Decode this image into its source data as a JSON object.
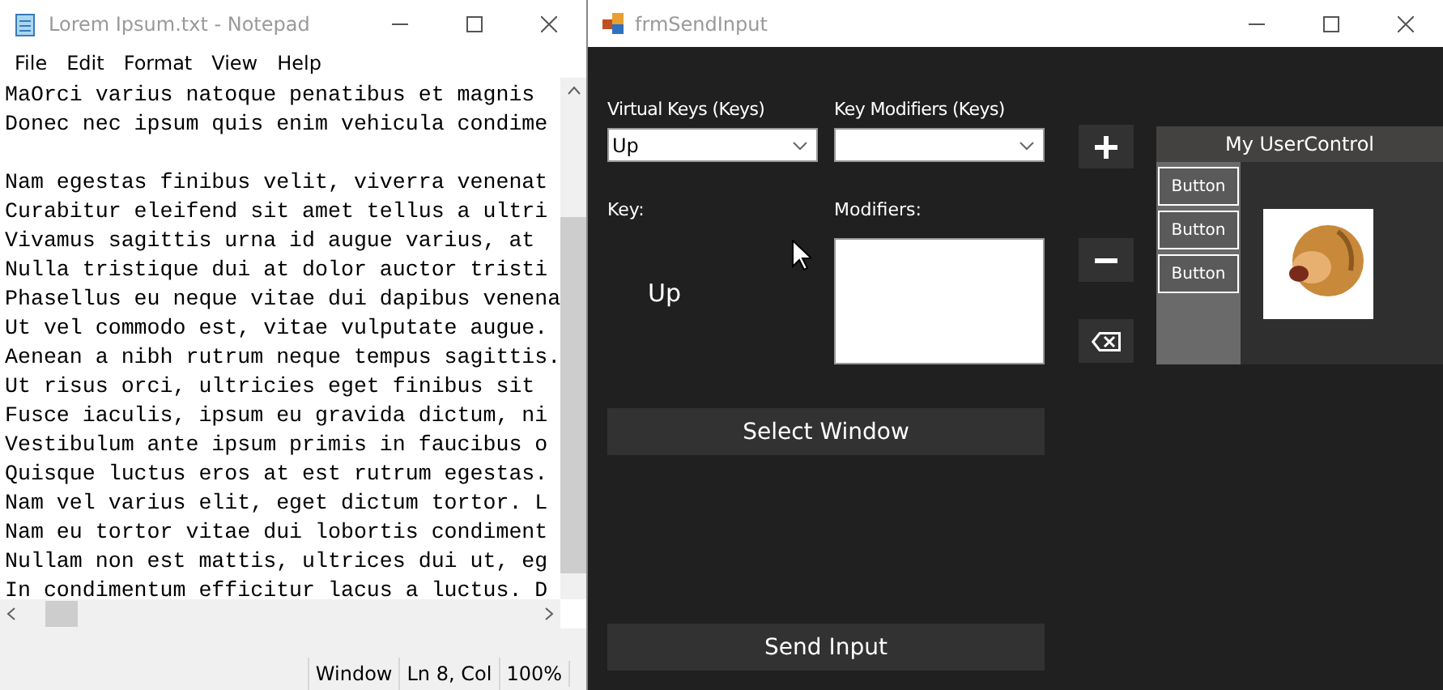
{
  "notepad": {
    "title": "Lorem Ipsum.txt - Notepad",
    "menu": [
      "File",
      "Edit",
      "Format",
      "View",
      "Help"
    ],
    "paragraphs": [
      [
        "MaOrci varius natoque penatibus et magnis",
        "Donec nec ipsum quis enim vehicula condime"
      ],
      [
        "Nam egestas finibus velit, viverra venenat",
        "Curabitur eleifend sit amet tellus a ultri",
        "Vivamus sagittis urna id augue varius, at",
        "Nulla tristique dui at dolor auctor tristi",
        "Phasellus eu neque vitae dui dapibus venena",
        "Ut vel commodo est, vitae vulputate augue.",
        "Aenean a nibh rutrum neque tempus sagittis.",
        "Ut risus orci, ultricies eget finibus sit",
        "Fusce iaculis, ipsum eu gravida dictum, ni",
        "Vestibulum ante ipsum primis in faucibus o",
        "Quisque luctus eros at est rutrum egestas.",
        "Nam vel varius elit, eget dictum tortor. L",
        "Nam eu tortor vitae dui lobortis condiment",
        "Nullam non est mattis, ultrices dui ut, eg",
        "In condimentum efficitur lacus a luctus. D"
      ]
    ],
    "status_bar": [
      "Window",
      "Ln 8, Col",
      "100%"
    ]
  },
  "send_input": {
    "title": "frmSendInput",
    "virtual_keys": {
      "label": "Virtual Keys (Keys)",
      "value": "Up"
    },
    "key_modifiers": {
      "label": "Key Modifiers (Keys)"
    },
    "key": {
      "label": "Key:",
      "value": "Up"
    },
    "modifiers": {
      "label": "Modifiers:"
    },
    "side_buttons": [
      {
        "kind": "add"
      },
      {
        "kind": "remove"
      },
      {
        "kind": "clear"
      }
    ],
    "user_control": {
      "title": "My UserControl",
      "buttons": [
        "Button",
        "Button",
        "Button"
      ]
    },
    "select_window": "Select Window",
    "send_input": "Send Input"
  }
}
